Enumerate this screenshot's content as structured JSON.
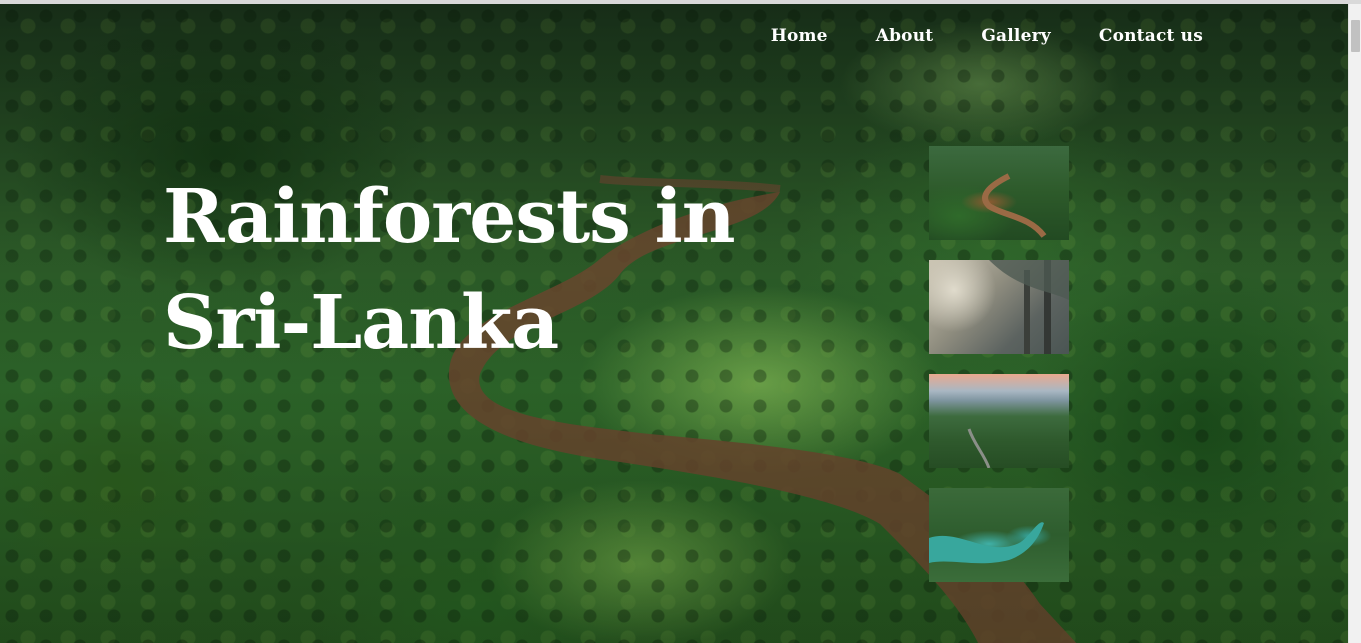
{
  "nav": {
    "items": [
      {
        "label": "Home"
      },
      {
        "label": "About"
      },
      {
        "label": "Gallery"
      },
      {
        "label": "Contact us"
      }
    ]
  },
  "hero": {
    "title": "Rainforests in Sri-Lanka",
    "background": "aerial view of rainforest with winding river"
  },
  "gallery": {
    "images": [
      {
        "alt": "winding river through forest"
      },
      {
        "alt": "sunlight through forest trees"
      },
      {
        "alt": "misty rainforest at sunset"
      },
      {
        "alt": "turquoise lake in forest"
      }
    ]
  },
  "colors": {
    "text": "#ffffff",
    "forest": "#2c5a28",
    "river": "#7a4f33"
  }
}
